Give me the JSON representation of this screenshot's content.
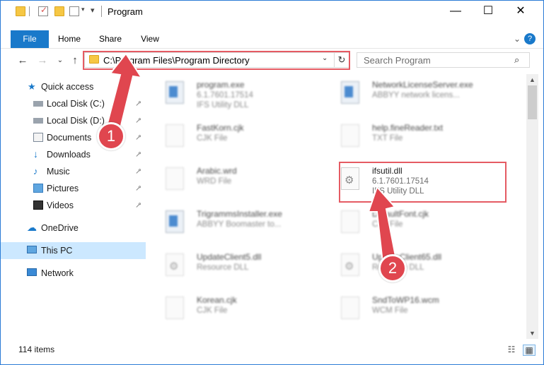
{
  "title_bar": {
    "title": "Program",
    "minimize": "—",
    "maximize": "☐",
    "close": "✕"
  },
  "ribbon": {
    "tabs": [
      "File",
      "Home",
      "Share",
      "View"
    ],
    "collapse_icon": "chevron-down-icon",
    "help_icon": "help-icon",
    "collapse_glyph": "⌄",
    "help_glyph": "?"
  },
  "nav": {
    "back_glyph": "←",
    "forward_glyph": "→",
    "recent_glyph": "⌄",
    "up_glyph": "↑",
    "address": "C:\\Program Files\\Program Directory",
    "dropdown_glyph": "⌄",
    "refresh_glyph": "↻",
    "search_placeholder": "Search Program",
    "search_glyph": "⌕"
  },
  "sidebar": {
    "items": [
      {
        "label": "Quick access",
        "icon": "star-icon",
        "pinned": false
      },
      {
        "label": "Local Disk (C:)",
        "icon": "drive-icon",
        "pinned": true
      },
      {
        "label": "Local Disk (D:)",
        "icon": "drive-icon",
        "pinned": true
      },
      {
        "label": "Documents",
        "icon": "documents-icon",
        "pinned": true
      },
      {
        "label": "Downloads",
        "icon": "downloads-icon",
        "pinned": true
      },
      {
        "label": "Music",
        "icon": "music-icon",
        "pinned": true
      },
      {
        "label": "Pictures",
        "icon": "pictures-icon",
        "pinned": true
      },
      {
        "label": "Videos",
        "icon": "videos-icon",
        "pinned": true
      },
      {
        "label": "OneDrive",
        "icon": "cloud-icon",
        "pinned": false
      },
      {
        "label": "This PC",
        "icon": "computer-icon",
        "pinned": false,
        "selected": true
      },
      {
        "label": "Network",
        "icon": "network-icon",
        "pinned": false
      }
    ],
    "pin_glyph": "📌"
  },
  "files": {
    "left": [
      {
        "name": "program.exe",
        "line1": "6.1.7601.17514",
        "line2": "IFS Utility DLL",
        "icon": "app"
      },
      {
        "name": "FastKorn.cjk",
        "line1": "CJK File",
        "icon": "doc"
      },
      {
        "name": "Arabic.wrd",
        "line1": "WRD File",
        "icon": "doc"
      },
      {
        "name": "TrigrammsInstaller.exe",
        "line1": "ABBYY Boomaster to...",
        "icon": "app"
      },
      {
        "name": "UpdateClient5.dll",
        "line1": "Resource DLL",
        "icon": "gear"
      },
      {
        "name": "Korean.cjk",
        "line1": "CJK File",
        "icon": "doc"
      }
    ],
    "right": [
      {
        "name": "NetworkLicenseServer.exe",
        "line1": "ABBYY network licens...",
        "icon": "app"
      },
      {
        "name": "help.fineReader.txt",
        "line1": "TXT File",
        "icon": "doc"
      },
      {
        "name": "ifsutil.dll",
        "line1": "6.1.7601.17514",
        "line2": "IFS Utility DLL",
        "icon": "gear"
      },
      {
        "name": "DefaultFont.cjk",
        "line1": "CJK File",
        "icon": "doc"
      },
      {
        "name": "UpdateClient65.dll",
        "line1": "Resource DLL",
        "icon": "gear"
      },
      {
        "name": "SndToWP16.wcm",
        "line1": "WCM File",
        "icon": "doc"
      }
    ]
  },
  "scrollbar": {
    "up_glyph": "▲",
    "down_glyph": "▼"
  },
  "status": {
    "item_count": "114 items",
    "details_view_glyph": "☷",
    "icons_view_glyph": "▦"
  },
  "annotations": {
    "step1": "1",
    "step2": "2",
    "accent_color": "#e55b63"
  }
}
